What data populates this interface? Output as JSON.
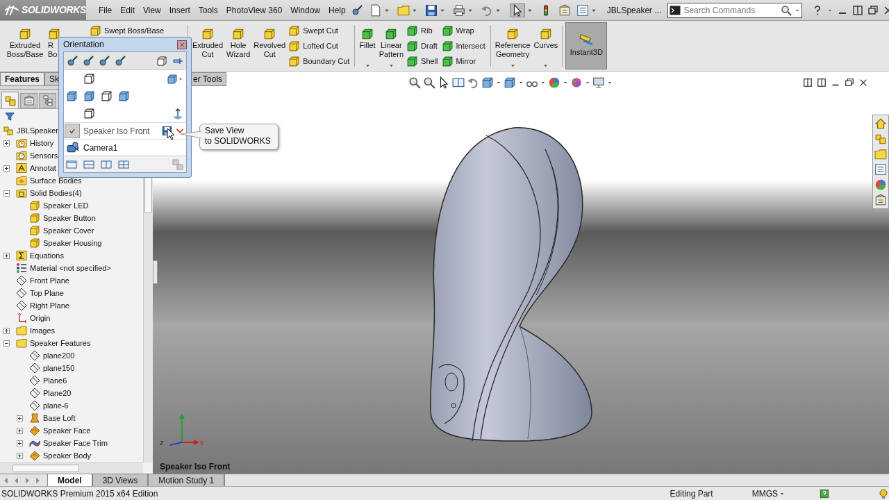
{
  "app_bar": {
    "logo": "SOLIDWORKS",
    "menus": [
      "File",
      "Edit",
      "View",
      "Insert",
      "Tools",
      "PhotoView 360",
      "Window",
      "Help"
    ],
    "document_title": "JBLSpeaker ...",
    "search": {
      "placeholder": "Search Commands"
    }
  },
  "ribbon": {
    "groups": [
      {
        "items": [
          {
            "kind": "large",
            "label": "Extruded\nBoss/Base",
            "dropdown": false
          },
          {
            "kind": "large",
            "label": "R\nBo",
            "dropdown": false
          },
          {
            "kind": "column",
            "entries": [
              "Swept Boss/Base"
            ]
          }
        ]
      },
      {
        "items": [
          {
            "kind": "large",
            "label": "Extruded\nCut",
            "dropdown": false
          },
          {
            "kind": "large",
            "label": "Hole\nWizard",
            "dropdown": false
          },
          {
            "kind": "large",
            "label": "Revolved\nCut",
            "dropdown": false
          },
          {
            "kind": "column",
            "entries": [
              "Swept Cut",
              "Lofted Cut",
              "Boundary Cut"
            ]
          }
        ]
      },
      {
        "items": [
          {
            "kind": "large",
            "label": "Fillet",
            "dropdown": true
          },
          {
            "kind": "large",
            "label": "Linear\nPattern",
            "dropdown": true
          },
          {
            "kind": "column",
            "entries": [
              "Rib",
              "Draft",
              "Shell"
            ]
          },
          {
            "kind": "column",
            "entries": [
              "Wrap",
              "Intersect",
              "Mirror"
            ]
          }
        ]
      },
      {
        "items": [
          {
            "kind": "large",
            "label": "Reference\nGeometry",
            "dropdown": true
          },
          {
            "kind": "large",
            "label": "Curves",
            "dropdown": true
          }
        ]
      },
      {
        "items": [
          {
            "kind": "toggle",
            "label": "Instant3D",
            "on": true
          }
        ]
      }
    ]
  },
  "command_tabs": [
    {
      "label": "Features",
      "selected": true
    },
    {
      "label": "Sk",
      "selected": false
    },
    {
      "label": "er Tools",
      "selected": false
    }
  ],
  "orientation_dialog": {
    "title": "Orientation",
    "saved_views": [
      {
        "kind": "view",
        "label": "Speaker Iso Front"
      },
      {
        "kind": "camera",
        "label": "Camera1"
      }
    ]
  },
  "tooltip": "Save View\nto SOLIDWORKS",
  "feature_tree": {
    "root": {
      "label": "JBLSpeaker",
      "kind": "part",
      "children": [
        {
          "label": "History",
          "kind": "history",
          "expanded": false
        },
        {
          "label": "Sensors",
          "kind": "sensors"
        },
        {
          "label": "Annotat",
          "kind": "annotations",
          "expanded": false
        },
        {
          "label": "Surface Bodies",
          "kind": "surface_folder"
        },
        {
          "label": "Solid Bodies(4)",
          "kind": "solid_folder",
          "expanded": true,
          "children": [
            {
              "label": "Speaker LED",
              "kind": "body"
            },
            {
              "label": "Speaker Button",
              "kind": "body"
            },
            {
              "label": "Speaker Cover",
              "kind": "body"
            },
            {
              "label": "Speaker Housing",
              "kind": "body"
            }
          ]
        },
        {
          "label": "Equations",
          "kind": "equations",
          "expanded": false
        },
        {
          "label": "Material <not specified>",
          "kind": "material"
        },
        {
          "label": "Front Plane",
          "kind": "plane"
        },
        {
          "label": "Top Plane",
          "kind": "plane"
        },
        {
          "label": "Right Plane",
          "kind": "plane"
        },
        {
          "label": "Origin",
          "kind": "origin"
        },
        {
          "label": "Images",
          "kind": "folder",
          "expanded": false
        },
        {
          "label": "Speaker Features",
          "kind": "folder",
          "expanded": true,
          "children": [
            {
              "label": "plane200",
              "kind": "plane"
            },
            {
              "label": "plane150",
              "kind": "plane"
            },
            {
              "label": "Plane6",
              "kind": "plane"
            },
            {
              "label": "Plane20",
              "kind": "plane"
            },
            {
              "label": "plane-6",
              "kind": "plane"
            },
            {
              "label": "Base Loft",
              "kind": "loft",
              "expanded": false
            },
            {
              "label": "Speaker Face",
              "kind": "surface",
              "expanded": false
            },
            {
              "label": "Speaker Face Trim",
              "kind": "trim",
              "expanded": false
            },
            {
              "label": "Speaker Body",
              "kind": "surface",
              "expanded": false
            }
          ]
        }
      ]
    }
  },
  "viewport": {
    "view_name": "Speaker Iso Front",
    "triad": [
      "Z",
      "X"
    ]
  },
  "bottom_tabs": [
    {
      "label": "Model",
      "selected": true
    },
    {
      "label": "3D Views",
      "selected": false
    },
    {
      "label": "Motion Study 1",
      "selected": false
    }
  ],
  "status_bar": {
    "edition": "SOLIDWORKS Premium 2015 x64 Edition",
    "mode": "Editing Part",
    "units": "MMGS"
  }
}
